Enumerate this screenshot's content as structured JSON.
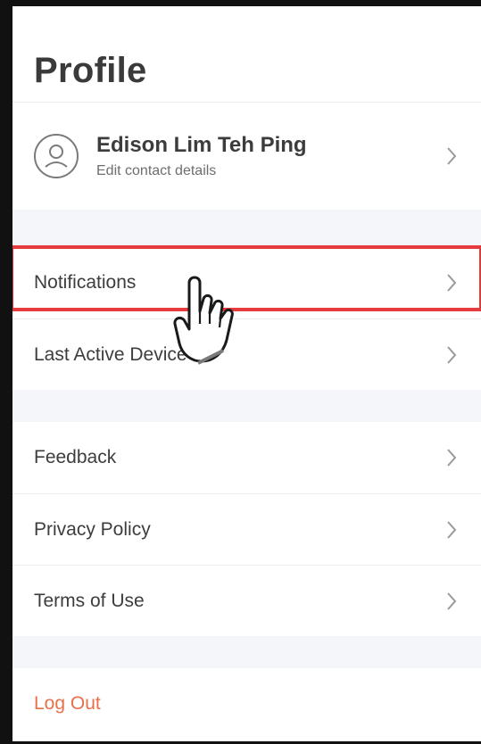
{
  "header": {
    "title": "Profile"
  },
  "profile": {
    "name": "Edison Lim Teh Ping",
    "subtitle": "Edit contact details",
    "avatar_icon": "user-circle-icon"
  },
  "menu": {
    "group1": [
      {
        "label": "Notifications",
        "icon": "chevron-right-icon"
      },
      {
        "label": "Last Active Device",
        "icon": "chevron-right-icon"
      }
    ],
    "group2": [
      {
        "label": "Feedback",
        "icon": "chevron-right-icon"
      },
      {
        "label": "Privacy Policy",
        "icon": "chevron-right-icon"
      },
      {
        "label": "Terms of Use",
        "icon": "chevron-right-icon"
      }
    ],
    "logout_label": "Log Out"
  },
  "colors": {
    "highlight": "#e53a3e",
    "logout": "#e8704a",
    "section_bg": "#f4f6f9"
  },
  "overlay": {
    "pointer_icon": "hand-pointer-icon",
    "highlighted_item": "Notifications"
  }
}
